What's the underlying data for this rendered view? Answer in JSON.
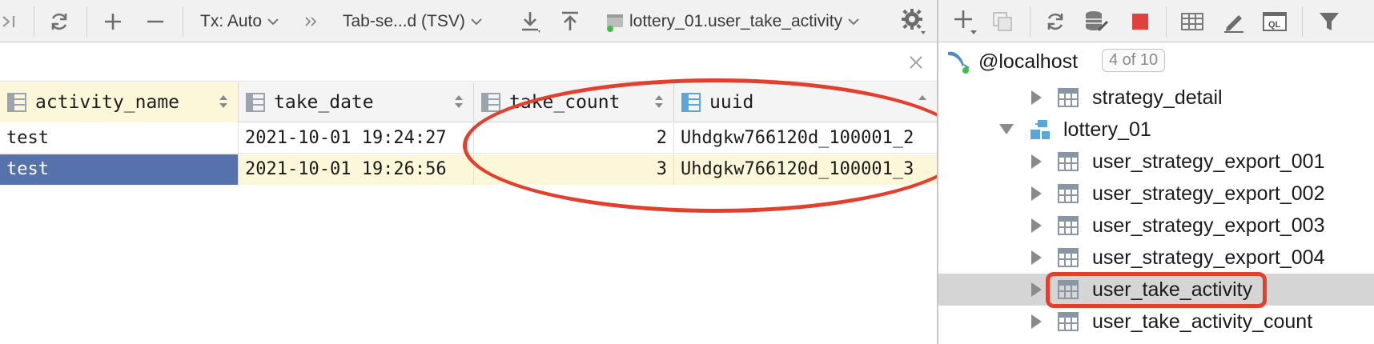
{
  "toolbar": {
    "tx_mode": "Tx: Auto",
    "export_format": "Tab-se...d (TSV)",
    "table_name": "lottery_01.user_take_activity"
  },
  "grid": {
    "columns": [
      "activity_name",
      "take_date",
      "take_count",
      "uuid"
    ],
    "rows": [
      {
        "activity_name": "test",
        "take_date": "2021-10-01 19:24:27",
        "take_count": "2",
        "uuid": "Uhdgkw766120d_100001_2"
      },
      {
        "activity_name": "test",
        "take_date": "2021-10-01 19:26:56",
        "take_count": "3",
        "uuid": "Uhdgkw766120d_100001_3"
      }
    ]
  },
  "tree": {
    "host": "@localhost",
    "host_badge": "4 of 10",
    "items": [
      {
        "label": "strategy_detail",
        "kind": "table"
      },
      {
        "label": "lottery_01",
        "kind": "schema"
      },
      {
        "label": "user_strategy_export_001",
        "kind": "table"
      },
      {
        "label": "user_strategy_export_002",
        "kind": "table"
      },
      {
        "label": "user_strategy_export_003",
        "kind": "table"
      },
      {
        "label": "user_strategy_export_004",
        "kind": "table"
      },
      {
        "label": "user_take_activity",
        "kind": "table"
      },
      {
        "label": "user_take_activity_count",
        "kind": "table"
      }
    ]
  },
  "colors": {
    "selection": "#5672ad",
    "highlight": "#fdf7da",
    "annotation": "#e2402d",
    "tree_selected": "#d5d5d5"
  }
}
